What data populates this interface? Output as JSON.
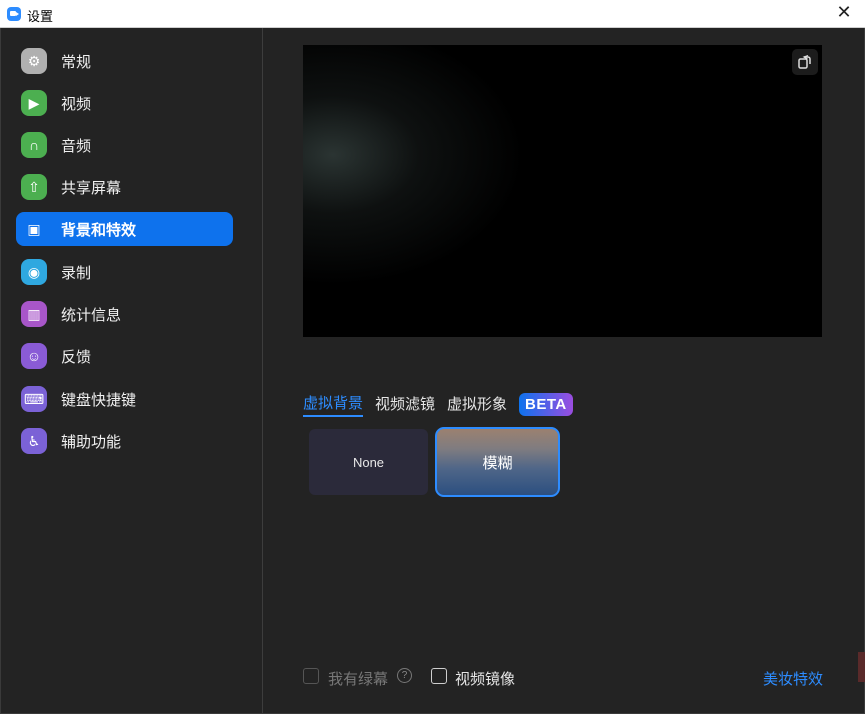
{
  "window": {
    "title": "设置",
    "close_glyph": "✕"
  },
  "sidebar": {
    "items": [
      {
        "label": "常规",
        "icon": "gear-icon",
        "color": "#b0b0b0",
        "glyph": "⚙",
        "active": false
      },
      {
        "label": "视频",
        "icon": "camera-icon",
        "color": "#4caf50",
        "glyph": "▶",
        "active": false
      },
      {
        "label": "音频",
        "icon": "headphones-icon",
        "color": "#4caf50",
        "glyph": "∩",
        "active": false
      },
      {
        "label": "共享屏幕",
        "icon": "share-screen-icon",
        "color": "#4caf50",
        "glyph": "⇧",
        "active": false
      },
      {
        "label": "背景和特效",
        "icon": "background-icon",
        "color": "#0e72ed",
        "glyph": "▣",
        "active": true
      },
      {
        "label": "录制",
        "icon": "record-icon",
        "color": "#2fa8e0",
        "glyph": "◉",
        "active": false
      },
      {
        "label": "统计信息",
        "icon": "statistics-icon",
        "color": "#a856c9",
        "glyph": "▥",
        "active": false
      },
      {
        "label": "反馈",
        "icon": "feedback-icon",
        "color": "#8a5bd6",
        "glyph": "☺",
        "active": false
      },
      {
        "label": "键盘快捷键",
        "icon": "keyboard-icon",
        "color": "#7b62d6",
        "glyph": "⌨",
        "active": false
      },
      {
        "label": "辅助功能",
        "icon": "accessibility-icon",
        "color": "#7b62d6",
        "glyph": "♿",
        "active": false
      }
    ]
  },
  "main": {
    "tabs": [
      {
        "label": "虚拟背景",
        "active": true
      },
      {
        "label": "视频滤镜",
        "active": false
      },
      {
        "label": "虚拟形象",
        "active": false
      }
    ],
    "beta_badge": "BETA",
    "backgrounds": {
      "none_label": "None",
      "blur_label": "模糊"
    },
    "footer": {
      "green_screen_label": "我有绿幕",
      "help_glyph": "?",
      "mirror_label": "视频镜像",
      "beauty_link": "美妆特效"
    }
  },
  "colors": {
    "accent": "#2d8cff",
    "active_bg": "#0e72ed",
    "panel_bg": "#232323"
  }
}
